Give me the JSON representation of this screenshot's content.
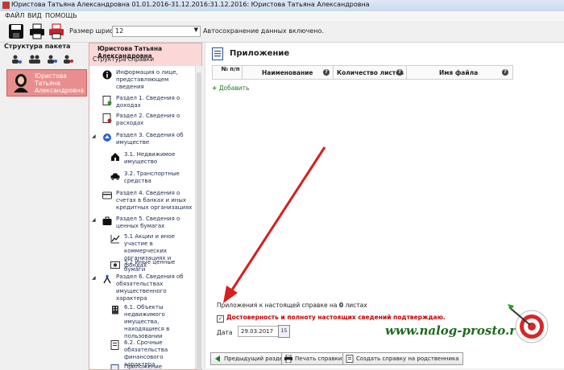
{
  "window": {
    "title": "Юристова Татьяна Александровна 01.01.2016-31.12.2016:31.12.2016: Юристова Татьяна Александровна"
  },
  "menu": {
    "file": "ФАЙЛ",
    "view": "ВИД",
    "help": "ПОМОЩЬ"
  },
  "toolbar": {
    "font_label": "Размер шрифта:",
    "font_value": "12",
    "autosave": "Автосохранение данных включено."
  },
  "package": {
    "title": "Структура пакета",
    "person": "Юристова Татьяна Александровна"
  },
  "structure": {
    "person": "Юристова Татьяна Александровна",
    "subtitle": "Структура справки",
    "items": [
      {
        "label": "Информация о лице, представляющем сведения",
        "icon": "info-icon"
      },
      {
        "label": "Раздел 1. Сведения о доходах",
        "icon": "income-doc-icon"
      },
      {
        "label": "Раздел 2. Сведения о расходах",
        "icon": "expense-doc-icon"
      },
      {
        "label": "Раздел 3. Сведения об имуществе",
        "icon": "property-icon"
      },
      {
        "label": "3.1. Недвижимое имущество",
        "icon": "house-icon"
      },
      {
        "label": "3.2. Транспортные средства",
        "icon": "car-icon"
      },
      {
        "label": "Раздел 4. Сведения о счетах в банках и иных кредитных организациях",
        "icon": "bank-card-icon"
      },
      {
        "label": "Раздел 5. Сведения о ценных бумагах",
        "icon": "briefcase-icon"
      },
      {
        "label": "5.1 Акции и иное участие в коммерческих организациях и фондах",
        "icon": "stock-chart-icon"
      },
      {
        "label": "5.2 Иные ценные бумаги",
        "icon": "securities-icon"
      },
      {
        "label": "Раздел 6. Сведения об обязательствах имущественного характера",
        "icon": "obligations-icon"
      },
      {
        "label": "6.1. Объекты недвижимого имущества, находящиеся в пользовании",
        "icon": "building-icon"
      },
      {
        "label": "6.2. Срочные обязательства финансового характера",
        "icon": "finance-doc-icon"
      },
      {
        "label": "Приложение",
        "icon": "attachment-icon"
      }
    ]
  },
  "main": {
    "title": "Приложение",
    "columns": {
      "num": "№ п/п",
      "name": "Наименование",
      "sheets": "Количество листов",
      "file": "Имя файла"
    },
    "add": "Добавить",
    "count_prefix": "Приложения к настоящей справке на",
    "count_value": "0",
    "count_suffix": "листах",
    "confirm": "Достоверность и полноту настоящих сведений подтверждаю.",
    "date_label": "Дата",
    "date_value": "29.03.2017",
    "calendar_day": "15",
    "buttons": {
      "prev": "Предыдущий раздел",
      "print": "Печать справки",
      "create": "Создать справку на родственника"
    }
  },
  "watermark": "www.nalog-prosto.ru",
  "colors": {
    "accent": "#e98e8e",
    "struct_head": "#fbd7d7",
    "confirm_red": "#c00000",
    "add_green": "#1e7d1e",
    "arrow_red": "#d81e1e"
  }
}
